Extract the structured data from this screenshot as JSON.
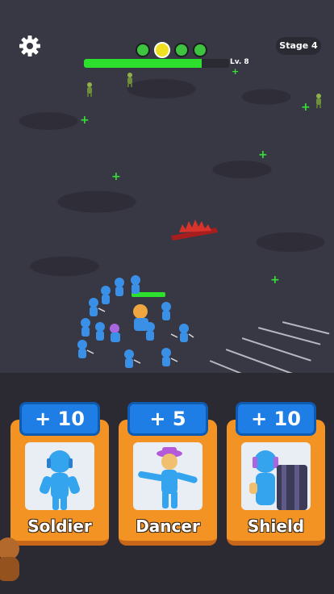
{
  "hud": {
    "stage_label": "Stage 4",
    "level_label": "Lv. 8",
    "xp_progress": 0.81,
    "stage_dots": [
      {
        "state": "done"
      },
      {
        "state": "current"
      },
      {
        "state": "upcoming"
      },
      {
        "state": "upcoming"
      }
    ],
    "settings_icon": "gear-icon"
  },
  "cards": [
    {
      "bonus": "+ 10",
      "label": "Soldier",
      "portrait_icon": "soldier-figure-icon"
    },
    {
      "bonus": "+ 5",
      "label": "Dancer",
      "portrait_icon": "dancer-figure-icon"
    },
    {
      "bonus": "+ 10",
      "label": "Shield",
      "portrait_icon": "shield-figure-icon"
    }
  ],
  "colors": {
    "card_orange": "#f39323",
    "tab_blue": "#1f7ee6",
    "unit_blue": "#3a8fe6",
    "health_green": "#2ee02e",
    "hazard_red": "#d8322a"
  }
}
